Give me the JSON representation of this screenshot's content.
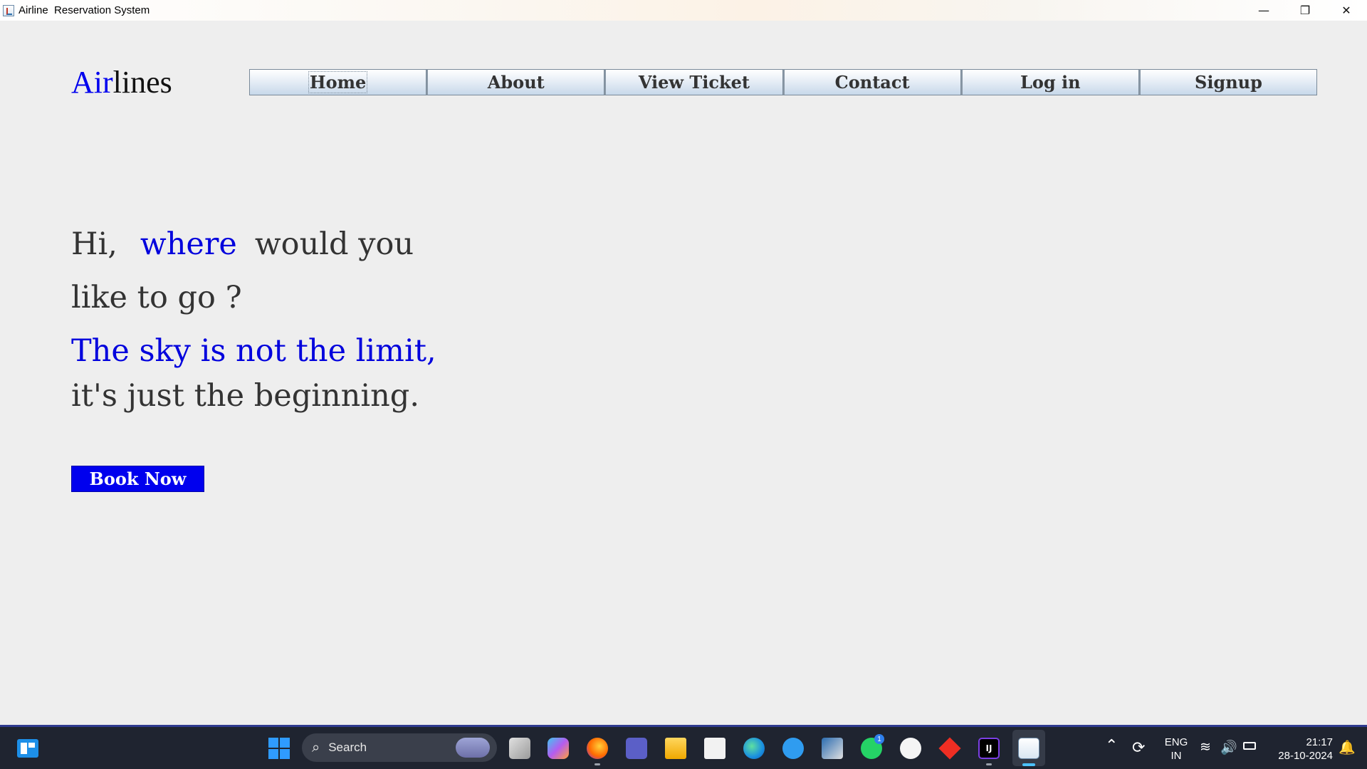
{
  "window": {
    "title": "Airline  Reservation System",
    "minimize_glyph": "—",
    "restore_glyph": "❐",
    "close_glyph": "✕"
  },
  "logo": {
    "part1": "Air",
    "part2": "lines"
  },
  "nav": {
    "items": [
      "Home",
      "About",
      "View Ticket",
      "Contact",
      "Log in",
      "Signup"
    ]
  },
  "hero": {
    "w1": "Hi,",
    "w2": "where",
    "w3": "would you",
    "line2": "like to go ?",
    "line3": "The sky is not the limit,",
    "line4": "it's just the beginning."
  },
  "book_button": "Book Now",
  "taskbar": {
    "search_placeholder": "Search",
    "search_glyph": "⌕",
    "whatsapp_badge": "1",
    "intellij_label": "IJ",
    "tray_up_glyph": "⌃",
    "lang_line1": "ENG",
    "lang_line2": "IN",
    "time": "21:17",
    "date": "28-10-2024"
  },
  "colors": {
    "accent_blue": "#0000ee",
    "text_dark": "#333333",
    "background": "#eeeeee",
    "taskbar": "#1f2430"
  }
}
